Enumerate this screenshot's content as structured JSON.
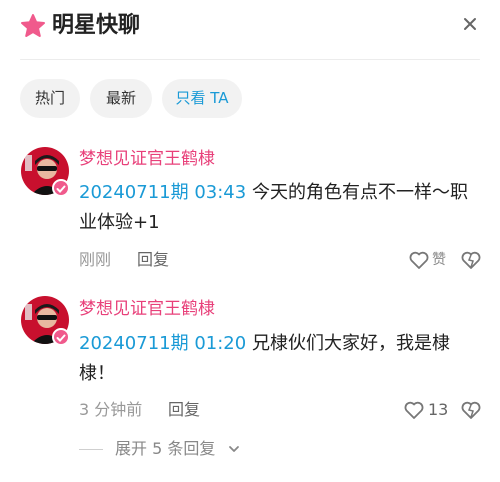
{
  "header": {
    "title": "明星快聊"
  },
  "filters": {
    "hot": "热门",
    "latest": "最新",
    "only_ta": "只看 TA"
  },
  "comments": [
    {
      "author": "梦想见证官王鹤棣",
      "timestamp": "20240711期 03:43",
      "text": " 今天的角色有点不一样～职业体验+1",
      "time": "刚刚",
      "reply": "回复",
      "like": "赞"
    },
    {
      "author": "梦想见证官王鹤棣",
      "timestamp": "20240711期 01:20",
      "text": " 兄棣伙们大家好，我是棣棣！",
      "time": "3 分钟前",
      "reply": "回复",
      "like": "13"
    }
  ],
  "expand_replies": "展开 5 条回复",
  "colors": {
    "accent_blue": "#1a9ad6",
    "author_pink": "#e8407a",
    "brand_pink": "#f05a8c"
  }
}
